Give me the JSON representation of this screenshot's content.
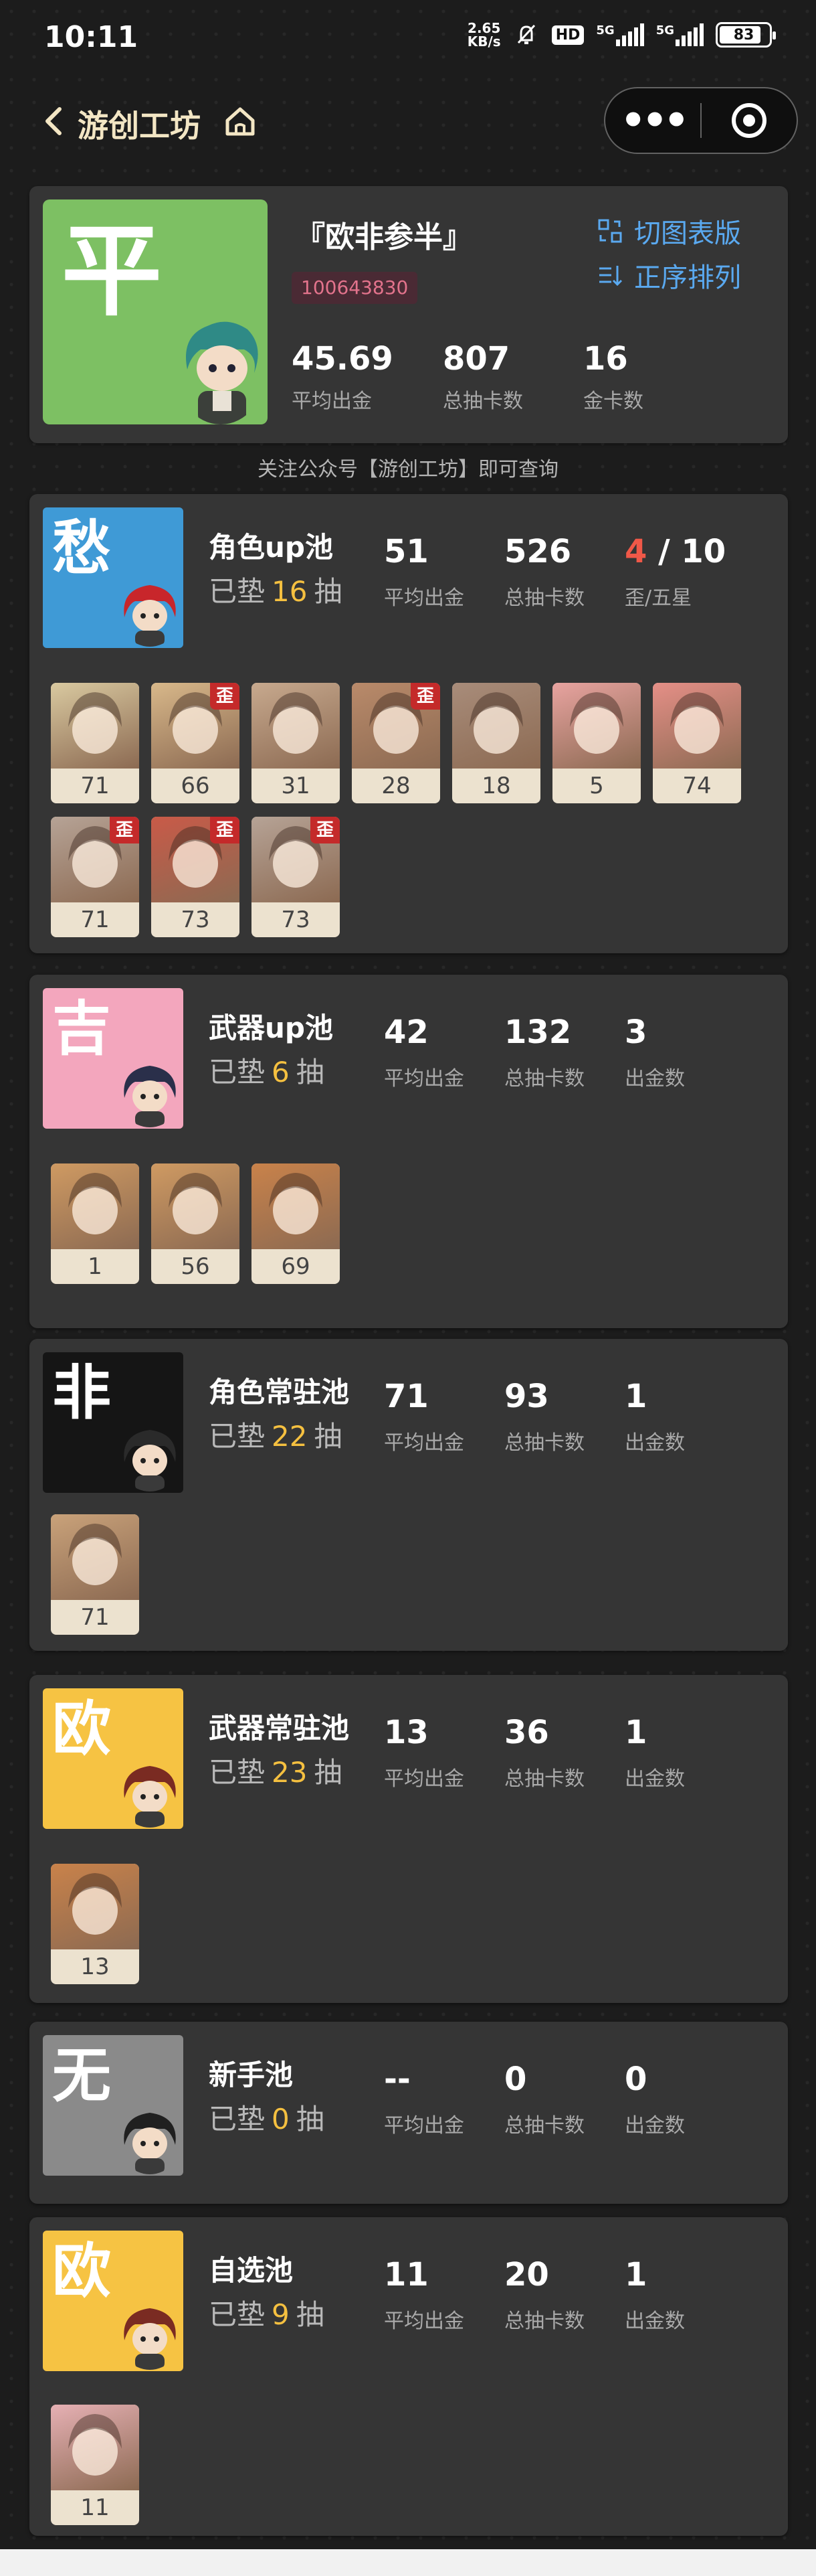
{
  "status_bar": {
    "time": "10:11",
    "net_speed_top": "2.65",
    "net_speed_bottom": "KB/s",
    "hd": "HD",
    "sig1": "5G",
    "sig2": "5G",
    "battery": "83",
    "battery_level": 0.83
  },
  "nav": {
    "title": "游创工坊"
  },
  "profile": {
    "rating": "平",
    "rating_color": "#7dc063",
    "name": "『欧非参半』",
    "uid": "100643830",
    "switch_label": "切图表版",
    "sort_label": "正序排列",
    "stats": [
      {
        "value": "45.69",
        "label": "平均出金"
      },
      {
        "value": "807",
        "label": "总抽卡数"
      },
      {
        "value": "16",
        "label": "金卡数"
      }
    ]
  },
  "notice": "关注公众号【游创工坊】即可查询",
  "odd_tag": "歪",
  "pity_prefix": "已垫",
  "pity_suffix": "抽",
  "pools": [
    {
      "rating": "愁",
      "rating_color": "#3f9ad6",
      "name": "角色up池",
      "pity": "16",
      "stats": [
        {
          "value": "51",
          "label": "平均出金"
        },
        {
          "value": "526",
          "label": "总抽卡数"
        },
        {
          "value_red": "4",
          "value_rest": " / 10",
          "label": "歪/五星"
        }
      ],
      "items": [
        {
          "count": "71",
          "odd": false,
          "art": "#d9c9a0"
        },
        {
          "count": "66",
          "odd": true,
          "art": "#d8b88a"
        },
        {
          "count": "31",
          "odd": false,
          "art": "#c7a98e"
        },
        {
          "count": "28",
          "odd": true,
          "art": "#b98a6a"
        },
        {
          "count": "18",
          "odd": false,
          "art": "#a88c7a"
        },
        {
          "count": "5",
          "odd": false,
          "art": "#e8a3a0"
        },
        {
          "count": "74",
          "odd": false,
          "art": "#e58f87"
        },
        {
          "count": "71",
          "odd": true,
          "art": "#b6a396"
        },
        {
          "count": "73",
          "odd": true,
          "art": "#c95a48"
        },
        {
          "count": "73",
          "odd": true,
          "art": "#b6a396"
        }
      ]
    },
    {
      "rating": "吉",
      "rating_color": "#f3a6bd",
      "name": "武器up池",
      "pity": "6",
      "stats": [
        {
          "value": "42",
          "label": "平均出金"
        },
        {
          "value": "132",
          "label": "总抽卡数"
        },
        {
          "value": "3",
          "label": "出金数"
        }
      ],
      "items": [
        {
          "count": "1",
          "odd": false,
          "art": "#cf9a62"
        },
        {
          "count": "56",
          "odd": false,
          "art": "#cf9a62"
        },
        {
          "count": "69",
          "odd": false,
          "art": "#c9824a"
        }
      ]
    },
    {
      "rating": "非",
      "rating_color": "#151515",
      "name": "角色常驻池",
      "pity": "22",
      "stats": [
        {
          "value": "71",
          "label": "平均出金"
        },
        {
          "value": "93",
          "label": "总抽卡数"
        },
        {
          "value": "1",
          "label": "出金数"
        }
      ],
      "items": [
        {
          "count": "71",
          "odd": false,
          "art": "#c9a27a"
        }
      ]
    },
    {
      "rating": "欧",
      "rating_color": "#f6c343",
      "name": "武器常驻池",
      "pity": "23",
      "stats": [
        {
          "value": "13",
          "label": "平均出金"
        },
        {
          "value": "36",
          "label": "总抽卡数"
        },
        {
          "value": "1",
          "label": "出金数"
        }
      ],
      "items": [
        {
          "count": "13",
          "odd": false,
          "art": "#c9824a"
        }
      ]
    },
    {
      "rating": "无",
      "rating_color": "#8a8a8a",
      "name": "新手池",
      "pity": "0",
      "stats": [
        {
          "value": "--",
          "label": "平均出金"
        },
        {
          "value": "0",
          "label": "总抽卡数"
        },
        {
          "value": "0",
          "label": "出金数"
        }
      ],
      "items": []
    },
    {
      "rating": "欧",
      "rating_color": "#f6c343",
      "name": "自选池",
      "pity": "9",
      "stats": [
        {
          "value": "11",
          "label": "平均出金"
        },
        {
          "value": "20",
          "label": "总抽卡数"
        },
        {
          "value": "1",
          "label": "出金数"
        }
      ],
      "items": [
        {
          "count": "11",
          "odd": false,
          "art": "#e6b0b4"
        }
      ]
    }
  ]
}
